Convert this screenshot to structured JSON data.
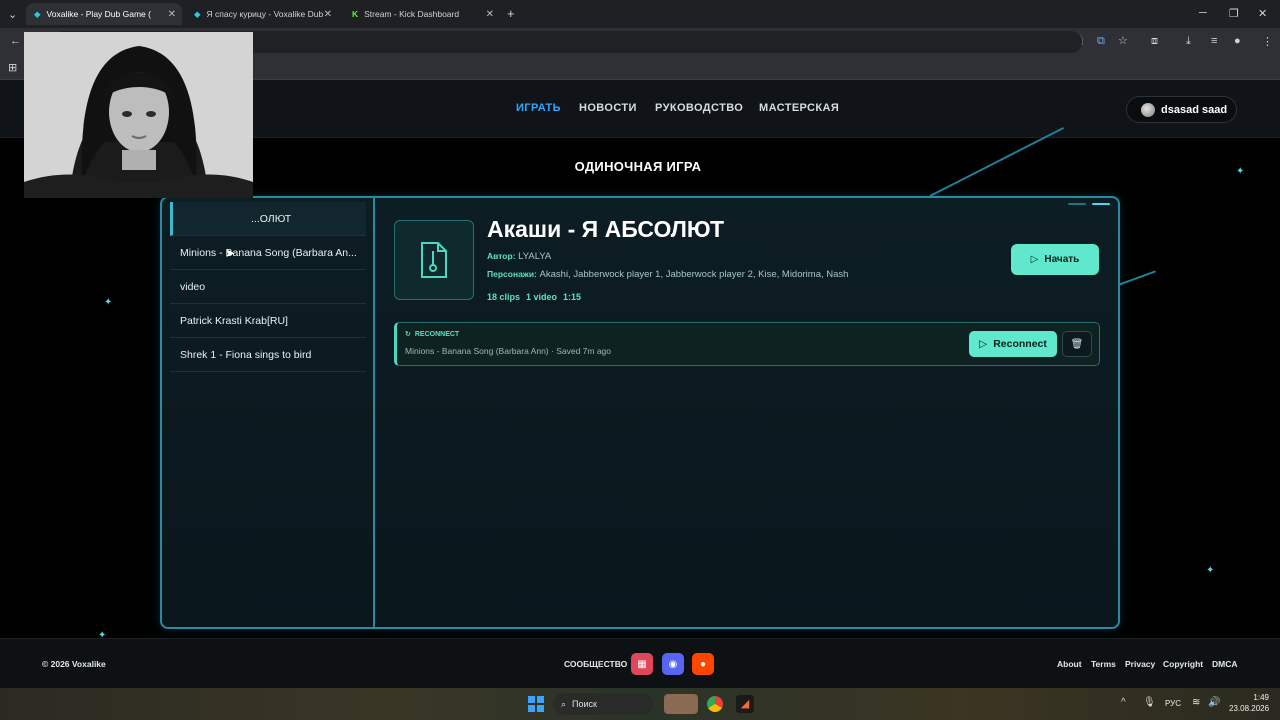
{
  "browser": {
    "tabs": [
      {
        "label": "Voxalike - Play Dub Game (",
        "active": true
      },
      {
        "label": "Я спасу курицу - Voxalike Dub",
        "active": false
      },
      {
        "label": "Stream - Kick Dashboard",
        "active": false
      }
    ],
    "new_tab": "+"
  },
  "nav": {
    "links": [
      "ИГРАТЬ",
      "НОВОСТИ",
      "РУКОВОДСТВО",
      "МАСТЕРСКАЯ"
    ],
    "active_index": 0,
    "user": "dsasad saad"
  },
  "page": {
    "title": "ОДИНОЧНАЯ ИГРА"
  },
  "sidebar": {
    "items": [
      "...ОЛЮТ",
      "Minions - Banana Song (Barbara An...",
      "video",
      "Patrick Krasti Krab[RU]",
      "Shrek 1 - Fiona sings to bird"
    ],
    "selected_index": 0
  },
  "game": {
    "title": "Акаши - Я АБСОЛЮТ",
    "author_label": "Автор:",
    "author": "LYALYA",
    "characters_label": "Персонажи:",
    "characters": "Akashi, Jabberwock player 1, Jabberwock player 2, Kise, Midorima, Nash",
    "clips": "18 clips",
    "videos": "1 video",
    "duration": "1:15",
    "start_label": "Начать"
  },
  "reconnect": {
    "label": "RECONNECT",
    "subtitle": "Minions - Banana Song (Barbara Ann) · Saved 7m ago",
    "button": "Reconnect"
  },
  "footer": {
    "copyright": "© 2026 Voxalike",
    "community": "СООБЩЕСТВО",
    "links": [
      "About",
      "Terms",
      "Privacy",
      "Copyright",
      "DMCA"
    ]
  },
  "taskbar": {
    "search": "Поиск",
    "lang": "РУС",
    "time": "1:49",
    "date": "23.08.2026"
  },
  "colors": {
    "accent": "#5fe8cc",
    "nav_active": "#2fa6ff",
    "panel_border": "#2a8aa0"
  }
}
